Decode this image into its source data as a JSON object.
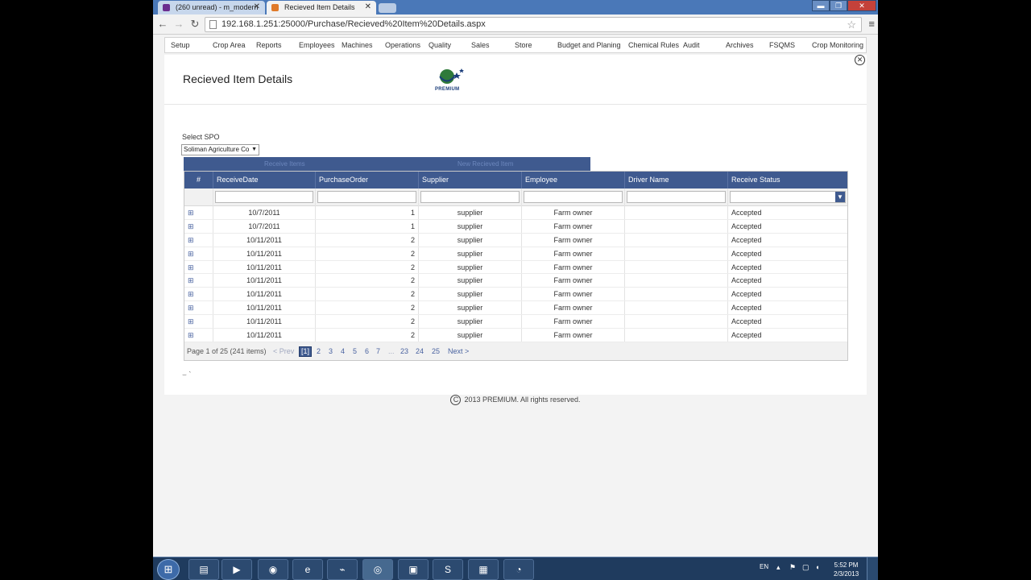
{
  "browser": {
    "tabs": [
      {
        "title": "(260 unread) - m_modern",
        "favicon": "yahoo-favicon",
        "active": false
      },
      {
        "title": "Recieved Item Details",
        "favicon": "page-favicon",
        "active": true
      }
    ],
    "url": "192.168.1.251:25000/Purchase/Recieved%20Item%20Details.aspx",
    "window_buttons": {
      "minimize": "▬",
      "maximize": "❐",
      "close": "✕"
    },
    "nav": {
      "back": "←",
      "forward": "→",
      "reload": "↻",
      "star": "☆",
      "menu": "≡"
    }
  },
  "app_nav": {
    "items": [
      "Setup",
      "Crop Area",
      "Reports",
      "Employees",
      "Machines",
      "Operations",
      "Quality",
      "Sales",
      "Store",
      "Budget and Planing",
      "Chemical Rules",
      "Audit",
      "Archives",
      "FSQMS",
      "Crop Monitoring"
    ]
  },
  "page": {
    "title": "Recieved Item Details",
    "logo_text": "PREMIUM",
    "close_symbol": "✕"
  },
  "spo": {
    "label": "Select SPO",
    "value": "Soliman Agriculture Co"
  },
  "subtabs": [
    "Receive Items",
    "New Recieved Item"
  ],
  "grid": {
    "columns": [
      "#",
      "ReceiveDate",
      "PurchaseOrder",
      "Supplier",
      "Employee",
      "Driver Name",
      "Receive Status"
    ],
    "expand_symbol": "⊞",
    "rows": [
      {
        "date": "10/7/2011",
        "po": "1",
        "supplier": "supplier",
        "employee": "Farm owner",
        "driver": "",
        "status": "Accepted"
      },
      {
        "date": "10/7/2011",
        "po": "1",
        "supplier": "supplier",
        "employee": "Farm owner",
        "driver": "",
        "status": "Accepted"
      },
      {
        "date": "10/11/2011",
        "po": "2",
        "supplier": "supplier",
        "employee": "Farm owner",
        "driver": "",
        "status": "Accepted"
      },
      {
        "date": "10/11/2011",
        "po": "2",
        "supplier": "supplier",
        "employee": "Farm owner",
        "driver": "",
        "status": "Accepted"
      },
      {
        "date": "10/11/2011",
        "po": "2",
        "supplier": "supplier",
        "employee": "Farm owner",
        "driver": "",
        "status": "Accepted"
      },
      {
        "date": "10/11/2011",
        "po": "2",
        "supplier": "supplier",
        "employee": "Farm owner",
        "driver": "",
        "status": "Accepted"
      },
      {
        "date": "10/11/2011",
        "po": "2",
        "supplier": "supplier",
        "employee": "Farm owner",
        "driver": "",
        "status": "Accepted"
      },
      {
        "date": "10/11/2011",
        "po": "2",
        "supplier": "supplier",
        "employee": "Farm owner",
        "driver": "",
        "status": "Accepted"
      },
      {
        "date": "10/11/2011",
        "po": "2",
        "supplier": "supplier",
        "employee": "Farm owner",
        "driver": "",
        "status": "Accepted"
      },
      {
        "date": "10/11/2011",
        "po": "2",
        "supplier": "supplier",
        "employee": "Farm owner",
        "driver": "",
        "status": "Accepted"
      }
    ],
    "pager": {
      "summary": "Page 1 of 25 (241 items)",
      "prev": "< Prev",
      "current": "[1]",
      "pages": [
        "2",
        "3",
        "4",
        "5",
        "6",
        "7",
        "...",
        "23",
        "24",
        "25"
      ],
      "next": "Next >"
    }
  },
  "footer": {
    "copyright_symbol": "C",
    "text": "2013 PREMIUM. All rights reserved."
  },
  "taskbar": {
    "start_icon": "windows-start-icon",
    "apps": [
      "explorer-icon",
      "media-player-icon",
      "firefox-icon",
      "ie-icon",
      "acrobat-icon",
      "chrome-icon",
      "network-app-icon",
      "skype-icon",
      "camera-app-icon",
      "messenger-icon"
    ],
    "language": "EN",
    "time": "5:52 PM",
    "date": "2/3/2013"
  },
  "colors": {
    "grid_header": "#3f5a8f",
    "taskbar": "#1f3b5e",
    "titlebar": "#4a78b8"
  }
}
